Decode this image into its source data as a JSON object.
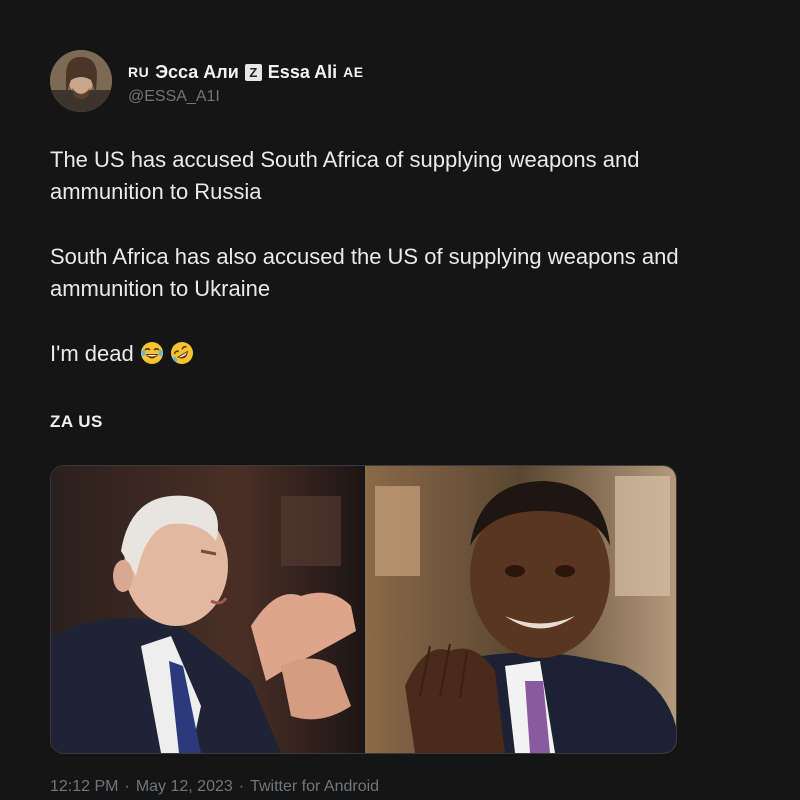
{
  "author": {
    "flag_code": "RU",
    "display_name_ru": "Эсса Али",
    "z_badge": "Z",
    "display_name_en": "Essa Ali",
    "flag_code_2": "AE",
    "handle": "@ESSA_A1I",
    "avatar_icon": "user-avatar-icon"
  },
  "tweet": {
    "paragraphs": [
      "The US has accused South Africa of supplying weapons and ammunition to Russia",
      "South Africa has also accused the US of supplying weapons and ammunition to Ukraine",
      "I'm dead"
    ],
    "emojis": [
      "tears-of-joy-emoji-icon",
      "rolling-on-floor-laughing-emoji-icon"
    ],
    "tag_line": "ZA US"
  },
  "media": {
    "images": [
      "man-gesturing-photo",
      "man-clapping-photo"
    ]
  },
  "meta": {
    "time": "12:12 PM",
    "separator": "·",
    "date": "May 12, 2023",
    "client": "Twitter for Android"
  },
  "colors": {
    "background": "#151515",
    "text": "#eaeaea",
    "muted": "#71767b"
  }
}
